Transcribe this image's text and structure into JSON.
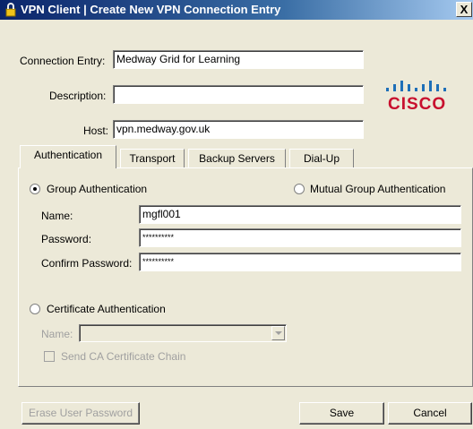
{
  "window": {
    "title": "VPN Client  |  Create New VPN Connection Entry",
    "close_label": "X"
  },
  "form": {
    "connection_entry_label": "Connection Entry:",
    "connection_entry_value": "Medway Grid for Learning",
    "description_label": "Description:",
    "description_value": "",
    "host_label": "Host:",
    "host_value": "vpn.medway.gov.uk"
  },
  "logo": {
    "text": "CISCO",
    "color": "#C8102E",
    "bars_color": "#1E6FB8"
  },
  "tabs": [
    {
      "label": "Authentication",
      "active": true
    },
    {
      "label": "Transport",
      "active": false
    },
    {
      "label": "Backup Servers",
      "active": false
    },
    {
      "label": "Dial-Up",
      "active": false
    }
  ],
  "auth": {
    "group_auth_label": "Group Authentication",
    "group_auth_selected": true,
    "mutual_auth_label": "Mutual Group Authentication",
    "mutual_auth_selected": false,
    "name_label": "Name:",
    "name_value": "mgfl001",
    "password_label": "Password:",
    "password_value": "**********",
    "confirm_password_label": "Confirm Password:",
    "confirm_password_value": "**********",
    "cert_auth_label": "Certificate Authentication",
    "cert_auth_selected": false,
    "cert_name_label": "Name:",
    "cert_name_value": "",
    "send_ca_label": "Send CA Certificate Chain",
    "send_ca_checked": false
  },
  "buttons": {
    "erase_password": "Erase User Password",
    "save": "Save",
    "cancel": "Cancel"
  }
}
